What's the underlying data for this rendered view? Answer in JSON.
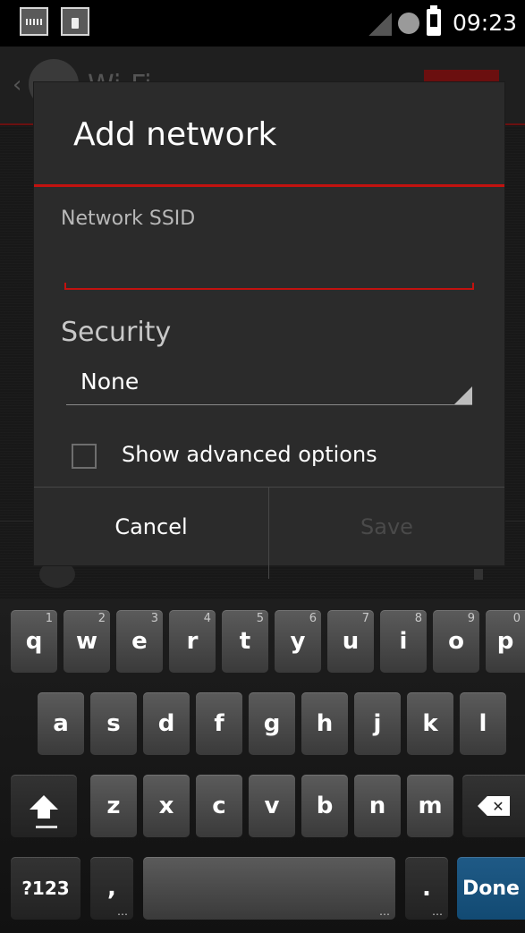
{
  "status_bar": {
    "time": "09:23",
    "icons": [
      "keyboard-icon",
      "usb-plug-icon",
      "signal-icon",
      "status-circle-icon",
      "battery-icon"
    ]
  },
  "background": {
    "title": "Wi-Fi",
    "toggle_color": "#6b0f0f"
  },
  "dialog": {
    "title": "Add network",
    "ssid_label": "Network SSID",
    "ssid_value": "",
    "security_label": "Security",
    "security_value": "None",
    "advanced_label": "Show advanced options",
    "advanced_checked": false,
    "cancel_label": "Cancel",
    "save_label": "Save",
    "accent_color": "#c2120f"
  },
  "keyboard": {
    "row1": [
      {
        "label": "q",
        "hint": "1"
      },
      {
        "label": "w",
        "hint": "2"
      },
      {
        "label": "e",
        "hint": "3"
      },
      {
        "label": "r",
        "hint": "4"
      },
      {
        "label": "t",
        "hint": "5"
      },
      {
        "label": "y",
        "hint": "6"
      },
      {
        "label": "u",
        "hint": "7"
      },
      {
        "label": "i",
        "hint": "8"
      },
      {
        "label": "o",
        "hint": "9"
      },
      {
        "label": "p",
        "hint": "0"
      }
    ],
    "row2": [
      "a",
      "s",
      "d",
      "f",
      "g",
      "h",
      "j",
      "k",
      "l"
    ],
    "row3": [
      "z",
      "x",
      "c",
      "v",
      "b",
      "n",
      "m"
    ],
    "symbols_label": "?123",
    "comma_label": ",",
    "period_label": ".",
    "done_label": "Done",
    "done_color": "#1f5a86"
  }
}
